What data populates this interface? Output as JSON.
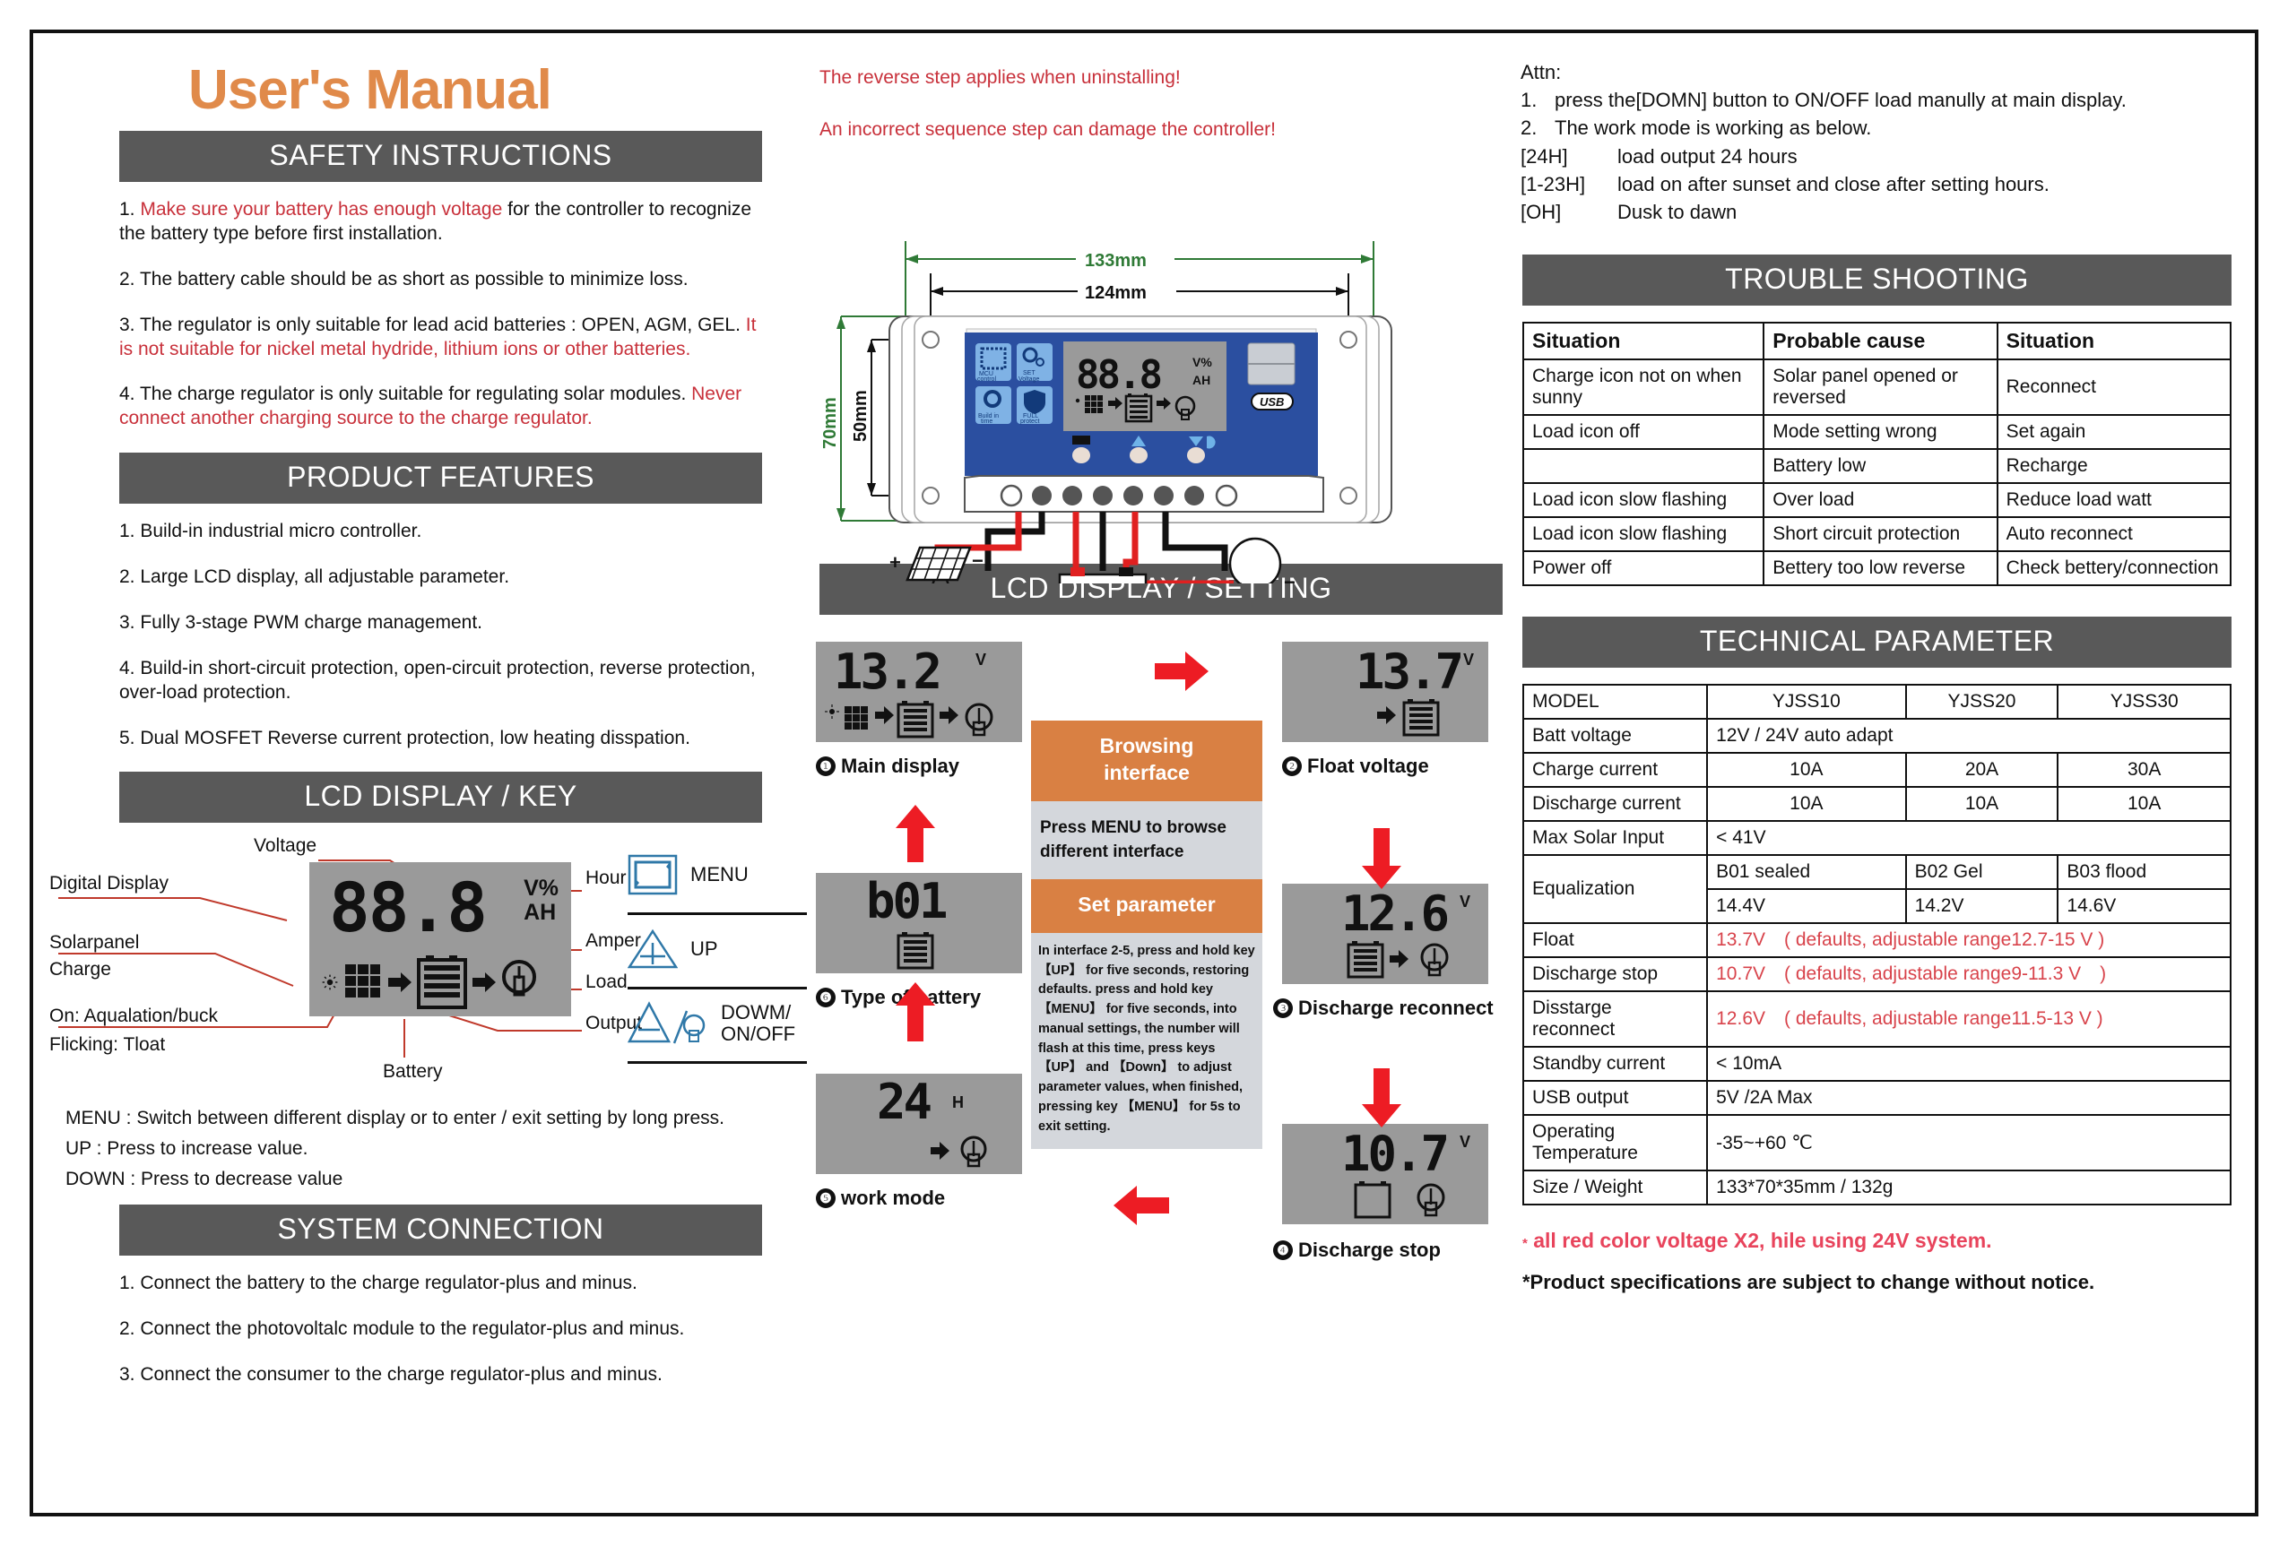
{
  "title": "User's Manual",
  "left": {
    "safety": {
      "heading": "SAFETY INSTRUCTIONS",
      "items": [
        {
          "num": "1.",
          "red_lead": "Make sure your battery has enough voltage",
          "rest": " for the controller to recognize the battery type before first installation."
        },
        {
          "num": "2.",
          "red_lead": "",
          "rest": "The battery cable should be as short as possible to minimize loss."
        },
        {
          "num": "3.",
          "black": "The regulator is only suitable for lead acid batteries : OPEN, AGM, GEL. ",
          "red_tail": "It is not suitable for nickel metal hydride, lithium ions or other batteries."
        },
        {
          "num": "4.",
          "black": "The charge regulator is only suitable for regulating solar modules. ",
          "red_tail": "Never connect another charging source to the charge regulator."
        }
      ]
    },
    "features": {
      "heading": "PRODUCT FEATURES",
      "items": [
        "1. Build-in industrial micro controller.",
        "2. Large LCD display, all adjustable parameter.",
        "3. Fully 3-stage PWM charge management.",
        "4. Build-in short-circuit protection, open-circuit protection, reverse protection, over-load protection.",
        "5. Dual MOSFET Reverse current protection, low heating disspation."
      ]
    },
    "lcdkey": {
      "heading": "LCD DISPLAY / KEY",
      "annotations": {
        "digital_display": "Digital Display",
        "voltage": "Voltage",
        "hour": "Hour",
        "amper": "Amper",
        "load": "Load",
        "output": "Output",
        "solarpanel": "Solarpanel",
        "charge": "Charge",
        "on_equal": "On: Aqualation/buck",
        "flicking": "Flicking: Tloat",
        "battery": "Battery"
      },
      "display_value": "88.8",
      "display_units_top": "V%",
      "display_units_bottom": "AH",
      "keys": [
        {
          "icon": "menu-loop-icon",
          "label": "MENU"
        },
        {
          "icon": "up-triangle-plus-icon",
          "label": "UP"
        },
        {
          "icon": "down-triangle-bulb-icon",
          "label": "DOWM/\nON/OFF"
        }
      ],
      "help": [
        "MENU :  Switch between different display or to enter / exit setting by long press.",
        "UP :       Press to increase value.",
        "DOWN : Press to decrease value"
      ]
    },
    "system": {
      "heading": "SYSTEM CONNECTION",
      "items": [
        "1. Connect the battery to the charge regulator-plus and minus.",
        "2. Connect the photovoltalc module to the regulator-plus and minus.",
        "3. Connect the consumer to the charge regulator-plus and minus."
      ]
    }
  },
  "mid": {
    "warnings": [
      "The reverse step applies when uninstalling!",
      "An incorrect sequence step can damage the controller!"
    ],
    "dimensions": {
      "width_outer": "133mm",
      "width_inner": "124mm",
      "height_outer": "70mm",
      "height_inner": "50mm"
    },
    "device": {
      "lcd_value": "88.8",
      "lcd_units_top": "V%",
      "lcd_units_bottom": "AH",
      "badges": [
        "MCU control",
        "SET Voltage",
        "Build in time",
        "FULL protect"
      ],
      "usb_label": "USB",
      "battery_plus": "+",
      "battery_minus": "−"
    },
    "lcdsetting": {
      "heading": "LCD DISPLAY / SETTING",
      "cards": [
        {
          "num": "❶",
          "caption": "Main display",
          "value": "13.2",
          "unit": "V",
          "icons": "sun-panel-battery-bulb"
        },
        {
          "num": "❷",
          "caption": "Float voltage",
          "value": "13.7",
          "unit": "V",
          "icons": "arrow-battery"
        },
        {
          "num": "❸",
          "caption": "Discharge reconnect",
          "value": "12.6",
          "unit": "V",
          "icons": "battery-arrow-bulb"
        },
        {
          "num": "❹",
          "caption": "Discharge stop",
          "value": "10.7",
          "unit": "V",
          "icons": "empty-battery-bulb"
        },
        {
          "num": "❺",
          "caption": "work mode",
          "value": "24",
          "unit": "H",
          "icons": "arrow-bulb"
        },
        {
          "num": "❻",
          "caption": "Type of battery",
          "value": "b01",
          "unit": "",
          "icons": "battery"
        }
      ],
      "browsing_title": "Browsing\ninterface",
      "browsing_body": "Press MENU to browse different interface",
      "setparam_title": "Set parameter",
      "setparam_body": "In interface 2-5, press and hold key 【UP】 for five seconds, restoring defaults. press and hold  key 【MENU】 for five seconds, into manual settings, the number will flash at this time, press keys 【UP】 and  【Down】 to adjust  parameter values, when finished, pressing  key  【MENU】 for 5s to exit  setting."
    }
  },
  "right": {
    "attn": {
      "title": "Attn:",
      "items": [
        {
          "num": "1.",
          "text": "press the[DOMN] button to ON/OFF load manully at main display."
        },
        {
          "num": "2.",
          "text": "The work mode is working as below."
        }
      ],
      "modes": [
        {
          "key": "[24H]",
          "text": "load output 24 hours"
        },
        {
          "key": "[1-23H]",
          "text": "load on after sunset and close after setting hours."
        },
        {
          "key": "[OH]",
          "text": "Dusk to dawn"
        }
      ]
    },
    "trouble": {
      "heading": "TROUBLE SHOOTING",
      "columns": [
        "Situation",
        "Probable cause",
        "Situation"
      ],
      "rows": [
        [
          "Charge icon not on when sunny",
          "Solar panel opened or reversed",
          "Reconnect"
        ],
        [
          "Load icon off",
          "Mode setting wrong",
          "Set again"
        ],
        [
          "",
          "Battery low",
          "Recharge"
        ],
        [
          "Load icon slow flashing",
          "Over load",
          "Reduce load watt"
        ],
        [
          "Load icon slow flashing",
          "Short circuit protection",
          "Auto reconnect"
        ],
        [
          "Power off",
          "Bettery too low reverse",
          "Check bettery/connection"
        ]
      ]
    },
    "tech": {
      "heading": "TECHNICAL PARAMETER",
      "model_label": "MODEL",
      "models": [
        "YJSS10",
        "YJSS20",
        "YJSS30"
      ],
      "rows": [
        {
          "label": "Batt voltage",
          "span": "12V / 24V auto adapt"
        },
        {
          "label": "Charge current",
          "cells": [
            "10A",
            "20A",
            "30A"
          ]
        },
        {
          "label": "Discharge current",
          "cells": [
            "10A",
            "10A",
            "10A"
          ]
        },
        {
          "label": "Max Solar Input",
          "span": "< 41V"
        }
      ],
      "equalization": {
        "label": "Equalization",
        "types": [
          "B01 sealed",
          "B02 Gel",
          "B03 flood"
        ],
        "volts": [
          "14.4V",
          "14.2V",
          "14.6V"
        ]
      },
      "red_rows": [
        {
          "label": "Float",
          "value": "13.7V ( defaults,  adjustable range12.7-15 V )"
        },
        {
          "label": "Discharge stop",
          "value": "10.7V ( defaults,  adjustable range9-11.3 V )"
        },
        {
          "label": "Disstarge reconnect",
          "value": "12.6V ( defaults,  adjustable range11.5-13 V )"
        }
      ],
      "tail_rows": [
        {
          "label": "Standby current",
          "value": "< 10mA"
        },
        {
          "label": "USB output",
          "value": "5V /2A Max"
        },
        {
          "label": "Operating Temperature",
          "value": "-35~+60 ℃"
        },
        {
          "label": "Size / Weight",
          "value": "133*70*35mm / 132g"
        }
      ]
    },
    "footnotes": {
      "red": "all red color voltage X2,  hile using 24V system.",
      "black": "*Product specifications are subject to change without notice."
    }
  },
  "colors": {
    "accent_orange": "#E08A4A",
    "bar_gray": "#595959",
    "red": "#C8303A",
    "lcd_gray": "#9a9a9a",
    "panel_blue": "#2b4fa0"
  }
}
